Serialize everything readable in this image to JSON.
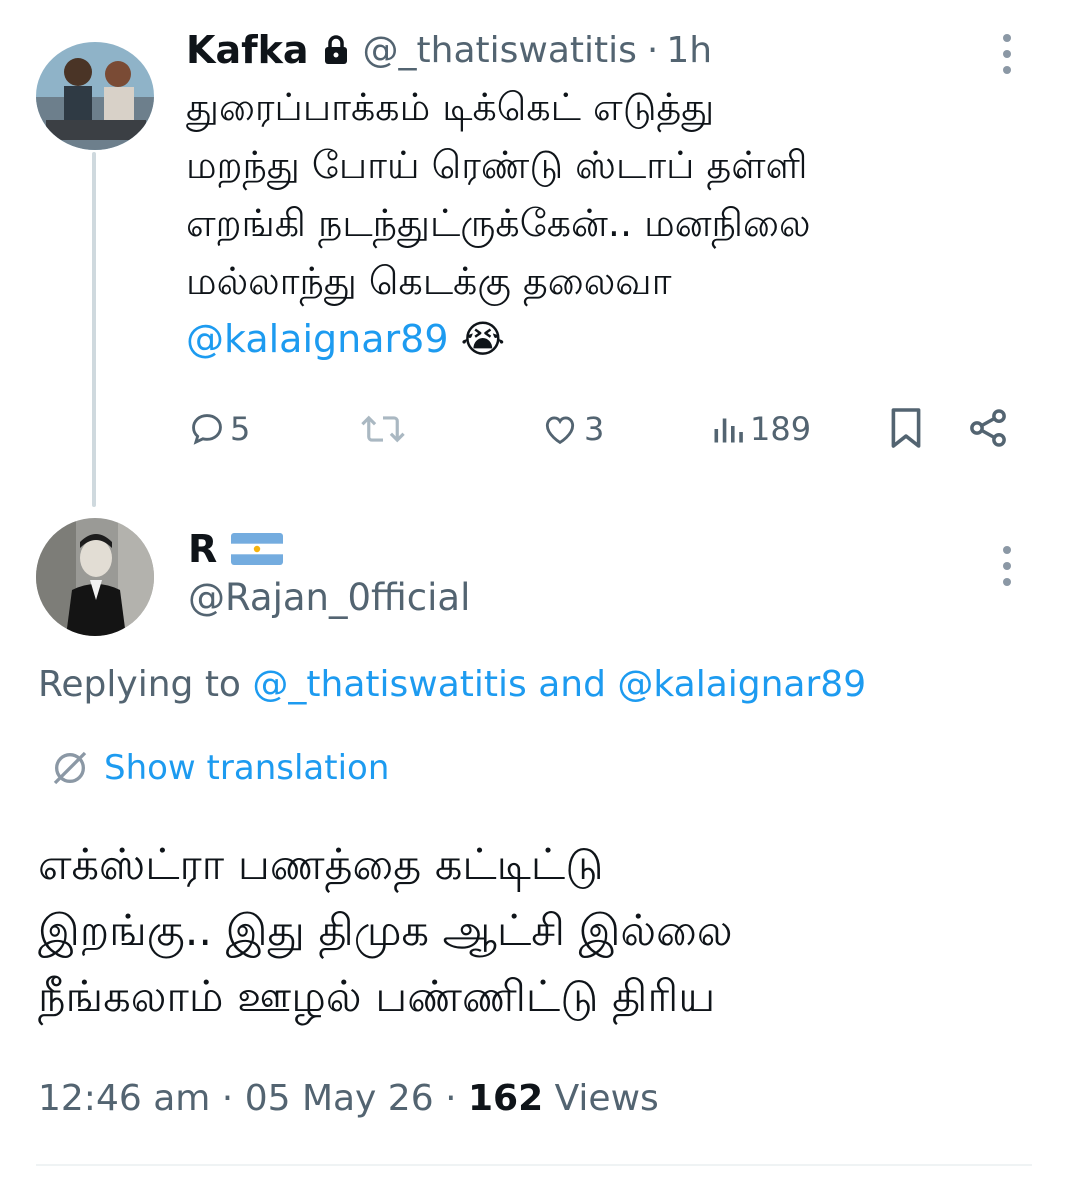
{
  "parent_tweet": {
    "display_name": "Kafka",
    "handle": "@_thatiswatitis",
    "separator": "·",
    "time": "1h",
    "lines": [
      "துரைப்பாக்கம் டிக்கெட் எடுத்து",
      "மறந்து போய் ரெண்டு ஸ்டாப் தள்ளி",
      "எறங்கி நடந்துட்ருக்கேன்.. மனநிலை",
      "மல்லாந்து கெடக்கு தலைவா"
    ],
    "mention": "@kalaignar89",
    "emoji": "😭",
    "replies": "5",
    "likes": "3",
    "views": "189"
  },
  "reply_tweet": {
    "display_name": "R",
    "flag": "🇦🇷",
    "handle": "@Rajan_0fficial",
    "replying_prefix": "Replying to",
    "replying_user1": "@_thatiswatitis",
    "replying_and": "and",
    "replying_user2": "@kalaignar89",
    "show_translation": "Show translation",
    "lines": [
      "எக்ஸ்ட்ரா பணத்தை கட்டிட்டு",
      "இறங்கு.. இது திமுக ஆட்சி இல்லை",
      "நீங்கலாம் ஊழல் பண்ணிட்டு திரிய"
    ],
    "time": "12:46 am",
    "sep1": "·",
    "date": "05 May 26",
    "sep2": "·",
    "views_count": "162",
    "views_label": "Views"
  },
  "colors": {
    "accent": "#1d9bf0",
    "secondary_text": "#536471",
    "divider": "#eff3f4"
  }
}
